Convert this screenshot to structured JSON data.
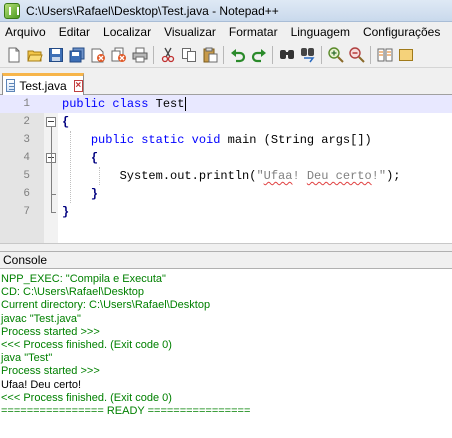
{
  "window": {
    "title": "C:\\Users\\Rafael\\Desktop\\Test.java - Notepad++"
  },
  "menu": [
    {
      "label": "Arquivo"
    },
    {
      "label": "Editar"
    },
    {
      "label": "Localizar"
    },
    {
      "label": "Visualizar"
    },
    {
      "label": "Formatar"
    },
    {
      "label": "Linguagem"
    },
    {
      "label": "Configurações"
    }
  ],
  "toolbar": {
    "icons": [
      "new-file-icon",
      "open-file-icon",
      "save-icon",
      "save-all-icon",
      "close-icon",
      "close-all-icon",
      "print-icon",
      "cut-icon",
      "copy-icon",
      "paste-icon",
      "undo-icon",
      "redo-icon",
      "find-icon",
      "replace-icon",
      "zoom-in-icon",
      "zoom-out-icon",
      "sync-scroll-icon"
    ]
  },
  "tab": {
    "label": "Test.java",
    "close": "×"
  },
  "editor": {
    "line_numbers": [
      "1",
      "2",
      "3",
      "4",
      "5",
      "6",
      "7"
    ],
    "lines": {
      "l1_kw1": "public",
      "l1_kw2": "class",
      "l1_name": " Test",
      "l2_brace": "{",
      "l3_kw1": "public",
      "l3_kw2": "static",
      "l3_kw3": "void",
      "l3_rest": " main (",
      "l3_type": "String",
      "l3_args": " args[])",
      "l4_brace": "{",
      "l5_call": "System.out.println(",
      "l5_q1": "\"",
      "l5_w1": "Ufaa",
      "l5_mid": "! ",
      "l5_w2": "Deu certo",
      "l5_q2": "!\"",
      "l5_end": ");",
      "l6_brace": "}",
      "l7_brace": "}"
    }
  },
  "console": {
    "title": "Console",
    "lines": [
      {
        "text": "NPP_EXEC: \"Compila e Executa\"",
        "color": "green"
      },
      {
        "text": "CD: C:\\Users\\Rafael\\Desktop",
        "color": "green"
      },
      {
        "text": "Current directory: C:\\Users\\Rafael\\Desktop",
        "color": "green"
      },
      {
        "text": "javac \"Test.java\"",
        "color": "green"
      },
      {
        "text": "Process started >>>",
        "color": "green"
      },
      {
        "text": "<<< Process finished. (Exit code 0)",
        "color": "green"
      },
      {
        "text": "java \"Test\"",
        "color": "green"
      },
      {
        "text": "Process started >>>",
        "color": "green"
      },
      {
        "text": "Ufaa! Deu certo!",
        "color": "black"
      },
      {
        "text": "<<< Process finished. (Exit code 0)",
        "color": "green"
      },
      {
        "text": "================ READY ================",
        "color": "green"
      }
    ]
  }
}
